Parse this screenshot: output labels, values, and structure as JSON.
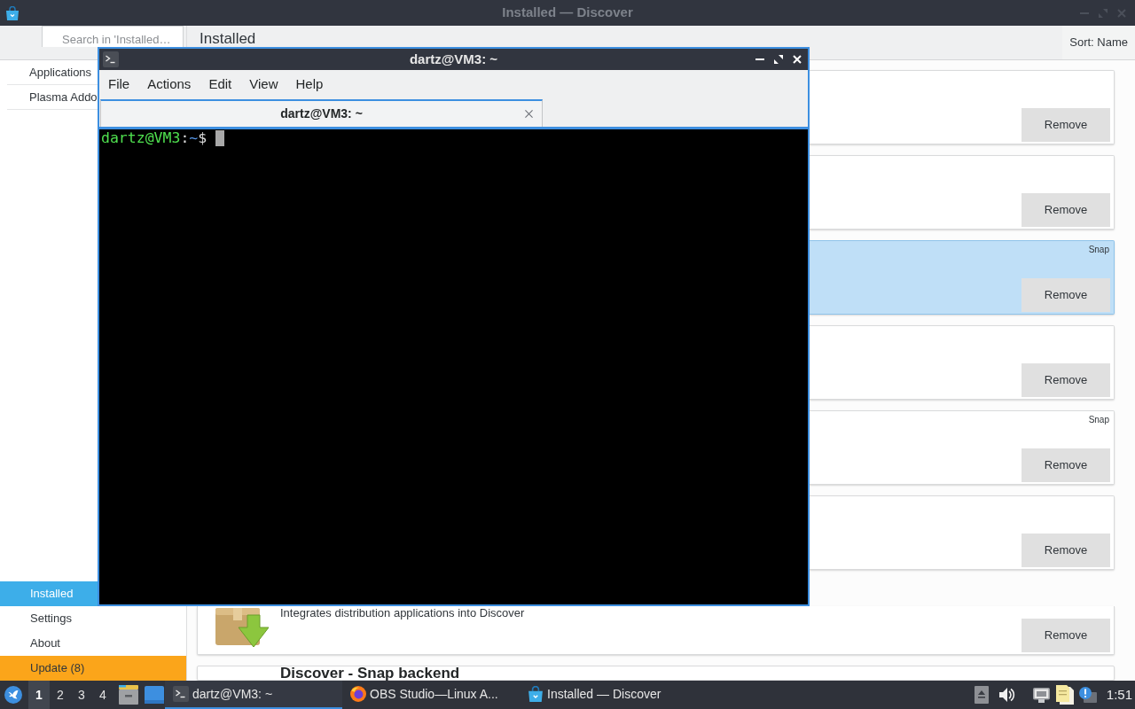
{
  "discover_window": {
    "title": "Installed — Discover",
    "active": false,
    "search": {
      "placeholder": "Search in 'Installed…"
    },
    "sidebar": {
      "sections": [
        {
          "label": "Applications",
          "selected": false
        },
        {
          "label": "Plasma Addo",
          "selected": false
        }
      ],
      "pages": [
        {
          "label": "Installed",
          "selected": true
        },
        {
          "label": "Settings",
          "selected": false
        },
        {
          "label": "About",
          "selected": false
        }
      ],
      "update_button": "Update (8)"
    },
    "header": {
      "title": "Installed",
      "sort": "Sort: Name"
    },
    "apps": [
      {
        "selected": false,
        "button": "Remove"
      },
      {
        "selected": false,
        "button": "Remove"
      },
      {
        "selected": true,
        "source": "Snap",
        "button": "Remove"
      },
      {
        "selected": false,
        "button": "Remove"
      },
      {
        "selected": false,
        "source": "Snap",
        "button": "Remove"
      },
      {
        "selected": false,
        "button": "Remove"
      },
      {
        "selected": false,
        "description": "Integrates distribution applications into Discover",
        "button": "Remove"
      },
      {
        "selected": false,
        "name": "Discover - Snap backend"
      }
    ]
  },
  "terminal_window": {
    "title": "dartz@VM3: ~",
    "active": true,
    "menu": [
      "File",
      "Actions",
      "Edit",
      "View",
      "Help"
    ],
    "tabs": [
      {
        "label": "dartz@VM3: ~",
        "selected": true
      }
    ],
    "prompt": {
      "user_host": "dartz@VM3",
      "separator": ":",
      "path": "~",
      "symbol": "$"
    }
  },
  "taskbar": {
    "desktops": [
      {
        "label": "1",
        "selected": true
      },
      {
        "label": "2",
        "selected": false
      },
      {
        "label": "3",
        "selected": false
      },
      {
        "label": "4",
        "selected": false
      }
    ],
    "tasks": [
      {
        "kind": "terminal",
        "label": "dartz@VM3: ~",
        "selected": true
      },
      {
        "kind": "browser",
        "label": "OBS Studio—Linux A...",
        "selected": false
      },
      {
        "kind": "store",
        "label": "Installed — Discover",
        "selected": false
      }
    ],
    "clock": "1:51"
  }
}
